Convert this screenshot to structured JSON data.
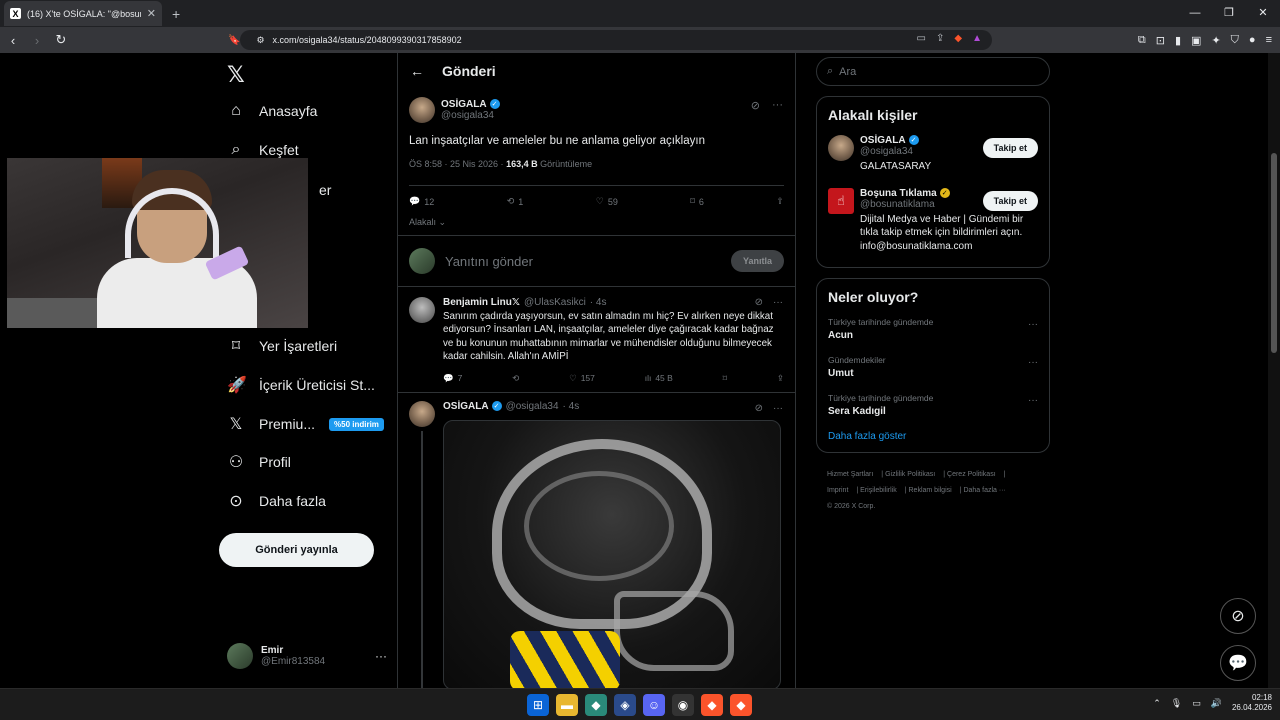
{
  "browser": {
    "tab_title": "(16) X'te OSİGALA: \"@bosunatik",
    "url": "x.com/osigala34/status/2048099390317858902"
  },
  "nav": {
    "items": [
      {
        "label": "Anasayfa",
        "icon": "home-icon"
      },
      {
        "label": "Keşfet",
        "icon": "search-icon"
      },
      {
        "label": "er",
        "icon": "bell-icon"
      },
      {
        "label": "Yer İşaretleri",
        "icon": "bookmark-icon"
      },
      {
        "label": "İçerik Üreticisi St...",
        "icon": "rocket-icon"
      },
      {
        "label": "Premiu...",
        "icon": "x-icon"
      },
      {
        "label": "Profil",
        "icon": "person-icon"
      },
      {
        "label": "Daha fazla",
        "icon": "more-circle-icon"
      }
    ],
    "premium_badge": "%50 indirim",
    "post_button": "Gönderi yayınla",
    "account_name": "Emir",
    "account_handle": "@Emir813584"
  },
  "header": {
    "title": "Gönderi"
  },
  "main_post": {
    "name": "OSİGALA",
    "handle": "@osigala34",
    "text": "Lan inşaatçılar ve ameleler bu ne anlama geliyor açıklayın",
    "time": "ÖS 8:58 · 25 Nis 2026 ·",
    "views_count": "163,4 B",
    "views_label": "Görüntüleme",
    "replies": "12",
    "reposts": "1",
    "likes": "59",
    "bookmarks": "6",
    "relevance": "Alakalı"
  },
  "reply_box": {
    "placeholder": "Yanıtını gönder",
    "button": "Yanıtla"
  },
  "reply": {
    "name": "Benjamin Linu𝕏",
    "handle": "@UlasKasikci",
    "time": "· 4s",
    "text": "Sanırım çadırda yaşıyorsun, ev satın almadın mı hiç? Ev alırken neye dikkat ediyorsun? İnsanları LAN, inşaatçılar, ameleler diye çağıracak kadar bağnaz ve bu konunun muhattabının mimarlar ve mühendisler olduğunu bilmeyecek kadar cahilsin. Allah'ın AMİPİ",
    "replies": "7",
    "likes": "157",
    "views": "45 B"
  },
  "post2": {
    "name": "OSİGALA",
    "handle": "@osigala34",
    "time": "· 4s"
  },
  "right": {
    "search_placeholder": "Ara",
    "relevant_title": "Alakalı kişiler",
    "people": [
      {
        "name": "OSİGALA",
        "handle": "@osigala34",
        "bio": "GALATASARAY",
        "follow": "Takip et"
      },
      {
        "name": "Boşuna Tıklama",
        "handle": "@bosunatiklama",
        "bio": "Dijital Medya ve Haber | Gündemi bir tıkla takip etmek için bildirimleri açın. info@bosunatiklama.com",
        "follow": "Takip et"
      }
    ],
    "trends_title": "Neler oluyor?",
    "trends": [
      {
        "context": "Türkiye tarihinde gündemde",
        "topic": "Acun"
      },
      {
        "context": "Gündemdekiler",
        "topic": "Umut"
      },
      {
        "context": "Türkiye tarihinde gündemde",
        "topic": "Sera Kadıgil"
      }
    ],
    "show_more": "Daha fazla göster",
    "footer_line1": [
      "Hizmet Şartları",
      "Gizlilik Politikası",
      "Çerez Politikası"
    ],
    "footer_line2": [
      "Imprint",
      "Erişilebilirlik",
      "Reklam bilgisi",
      "Daha fazla ···"
    ],
    "copyright": "© 2026 X Corp."
  },
  "taskbar": {
    "time": "02:18",
    "date": "26.04.2026"
  }
}
